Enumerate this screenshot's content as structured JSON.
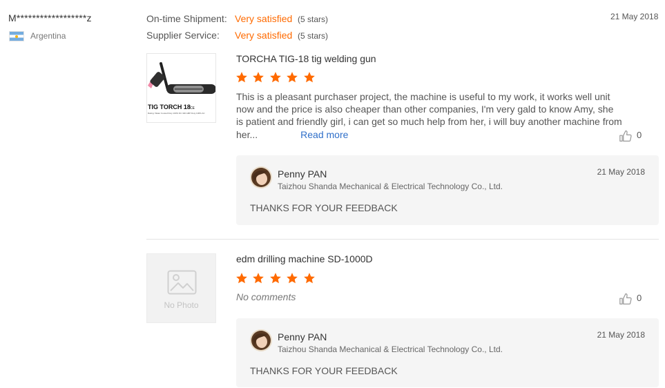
{
  "buyer": {
    "name": "M******************z",
    "country": "Argentina"
  },
  "ratings": [
    {
      "label": "On-time Shipment:",
      "value": "Very satisfied",
      "count": "(5 stars)"
    },
    {
      "label": "Supplier Service:",
      "value": "Very satisfied",
      "count": "(5 stars)"
    }
  ],
  "review_date": "21 May 2018",
  "products": [
    {
      "title": "TORCHA TIG-18 tig welding gun",
      "stars": 5,
      "thumb_text": "TIG TORCH 18",
      "thumb_small": "Rating: Water Cooled Duty 100% DC 320 AMP Duty 100% AC",
      "comment": "This is a pleasant purchaser project, the machine is useful to my work, it works well unit now and the price is also cheaper than other companies, I'm very gald to know Amy, she is patient and friendly girl, i can get so much help from her, i will buy another machine from her...",
      "read_more": "Read more",
      "likes": "0",
      "reply": {
        "name": "Penny PAN",
        "company": "Taizhou Shanda Mechanical & Electrical Technology Co., Ltd.",
        "date": "21 May 2018",
        "text": "THANKS FOR YOUR FEEDBACK"
      }
    },
    {
      "title": "edm drilling machine SD-1000D",
      "stars": 5,
      "no_photo": "No Photo",
      "comment": "No comments",
      "likes": "0",
      "reply": {
        "name": "Penny PAN",
        "company": "Taizhou Shanda Mechanical & Electrical Technology Co., Ltd.",
        "date": "21 May 2018",
        "text": "THANKS FOR YOUR FEEDBACK"
      }
    }
  ],
  "colors": {
    "accent": "#ff6a00",
    "link": "#2f6fc9",
    "reply_bg": "#f5f5f5"
  },
  "icons": {
    "star": "star-icon",
    "like": "thumbs-up-icon",
    "no_photo": "image-placeholder-icon",
    "flag": "argentina-flag-icon"
  }
}
